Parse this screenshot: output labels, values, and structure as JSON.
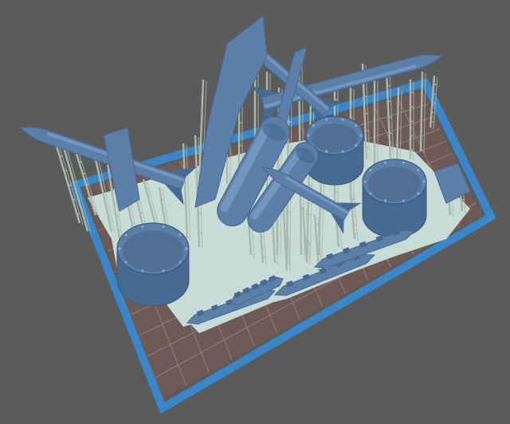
{
  "viewport": {
    "kind": "3d-print-slicer-preview",
    "background_color": "#5b5b5b"
  },
  "build_plate": {
    "border_color": "#3a86c8",
    "surface_color": "#6e5a55",
    "grid_color": "#8a7b76"
  },
  "raft": {
    "color": "#c7dbd7"
  },
  "supports": {
    "color": "#a8b8aa",
    "count_visual": "many"
  },
  "parts": {
    "color": "#5b7fa9",
    "shade_color": "#476a91",
    "highlight_color": "#88a8cf",
    "items": [
      {
        "id": "missile-left",
        "icon": "missile-icon"
      },
      {
        "id": "missile-top-center",
        "icon": "missile-icon"
      },
      {
        "id": "missile-top-right",
        "icon": "missile-icon"
      },
      {
        "id": "missile-center",
        "icon": "missile-icon"
      },
      {
        "id": "fuel-tank-large",
        "icon": "capsule-icon"
      },
      {
        "id": "fuel-tank-mid",
        "icon": "capsule-icon"
      },
      {
        "id": "intake-ring-left",
        "icon": "ring-icon"
      },
      {
        "id": "intake-ring-center",
        "icon": "ring-icon"
      },
      {
        "id": "intake-ring-right",
        "icon": "ring-icon"
      },
      {
        "id": "pylon-strip-1",
        "icon": "strip-icon"
      },
      {
        "id": "pylon-strip-2",
        "icon": "strip-icon"
      },
      {
        "id": "pylon-strip-3",
        "icon": "strip-icon"
      },
      {
        "id": "pylon-strip-4",
        "icon": "strip-icon"
      }
    ]
  }
}
